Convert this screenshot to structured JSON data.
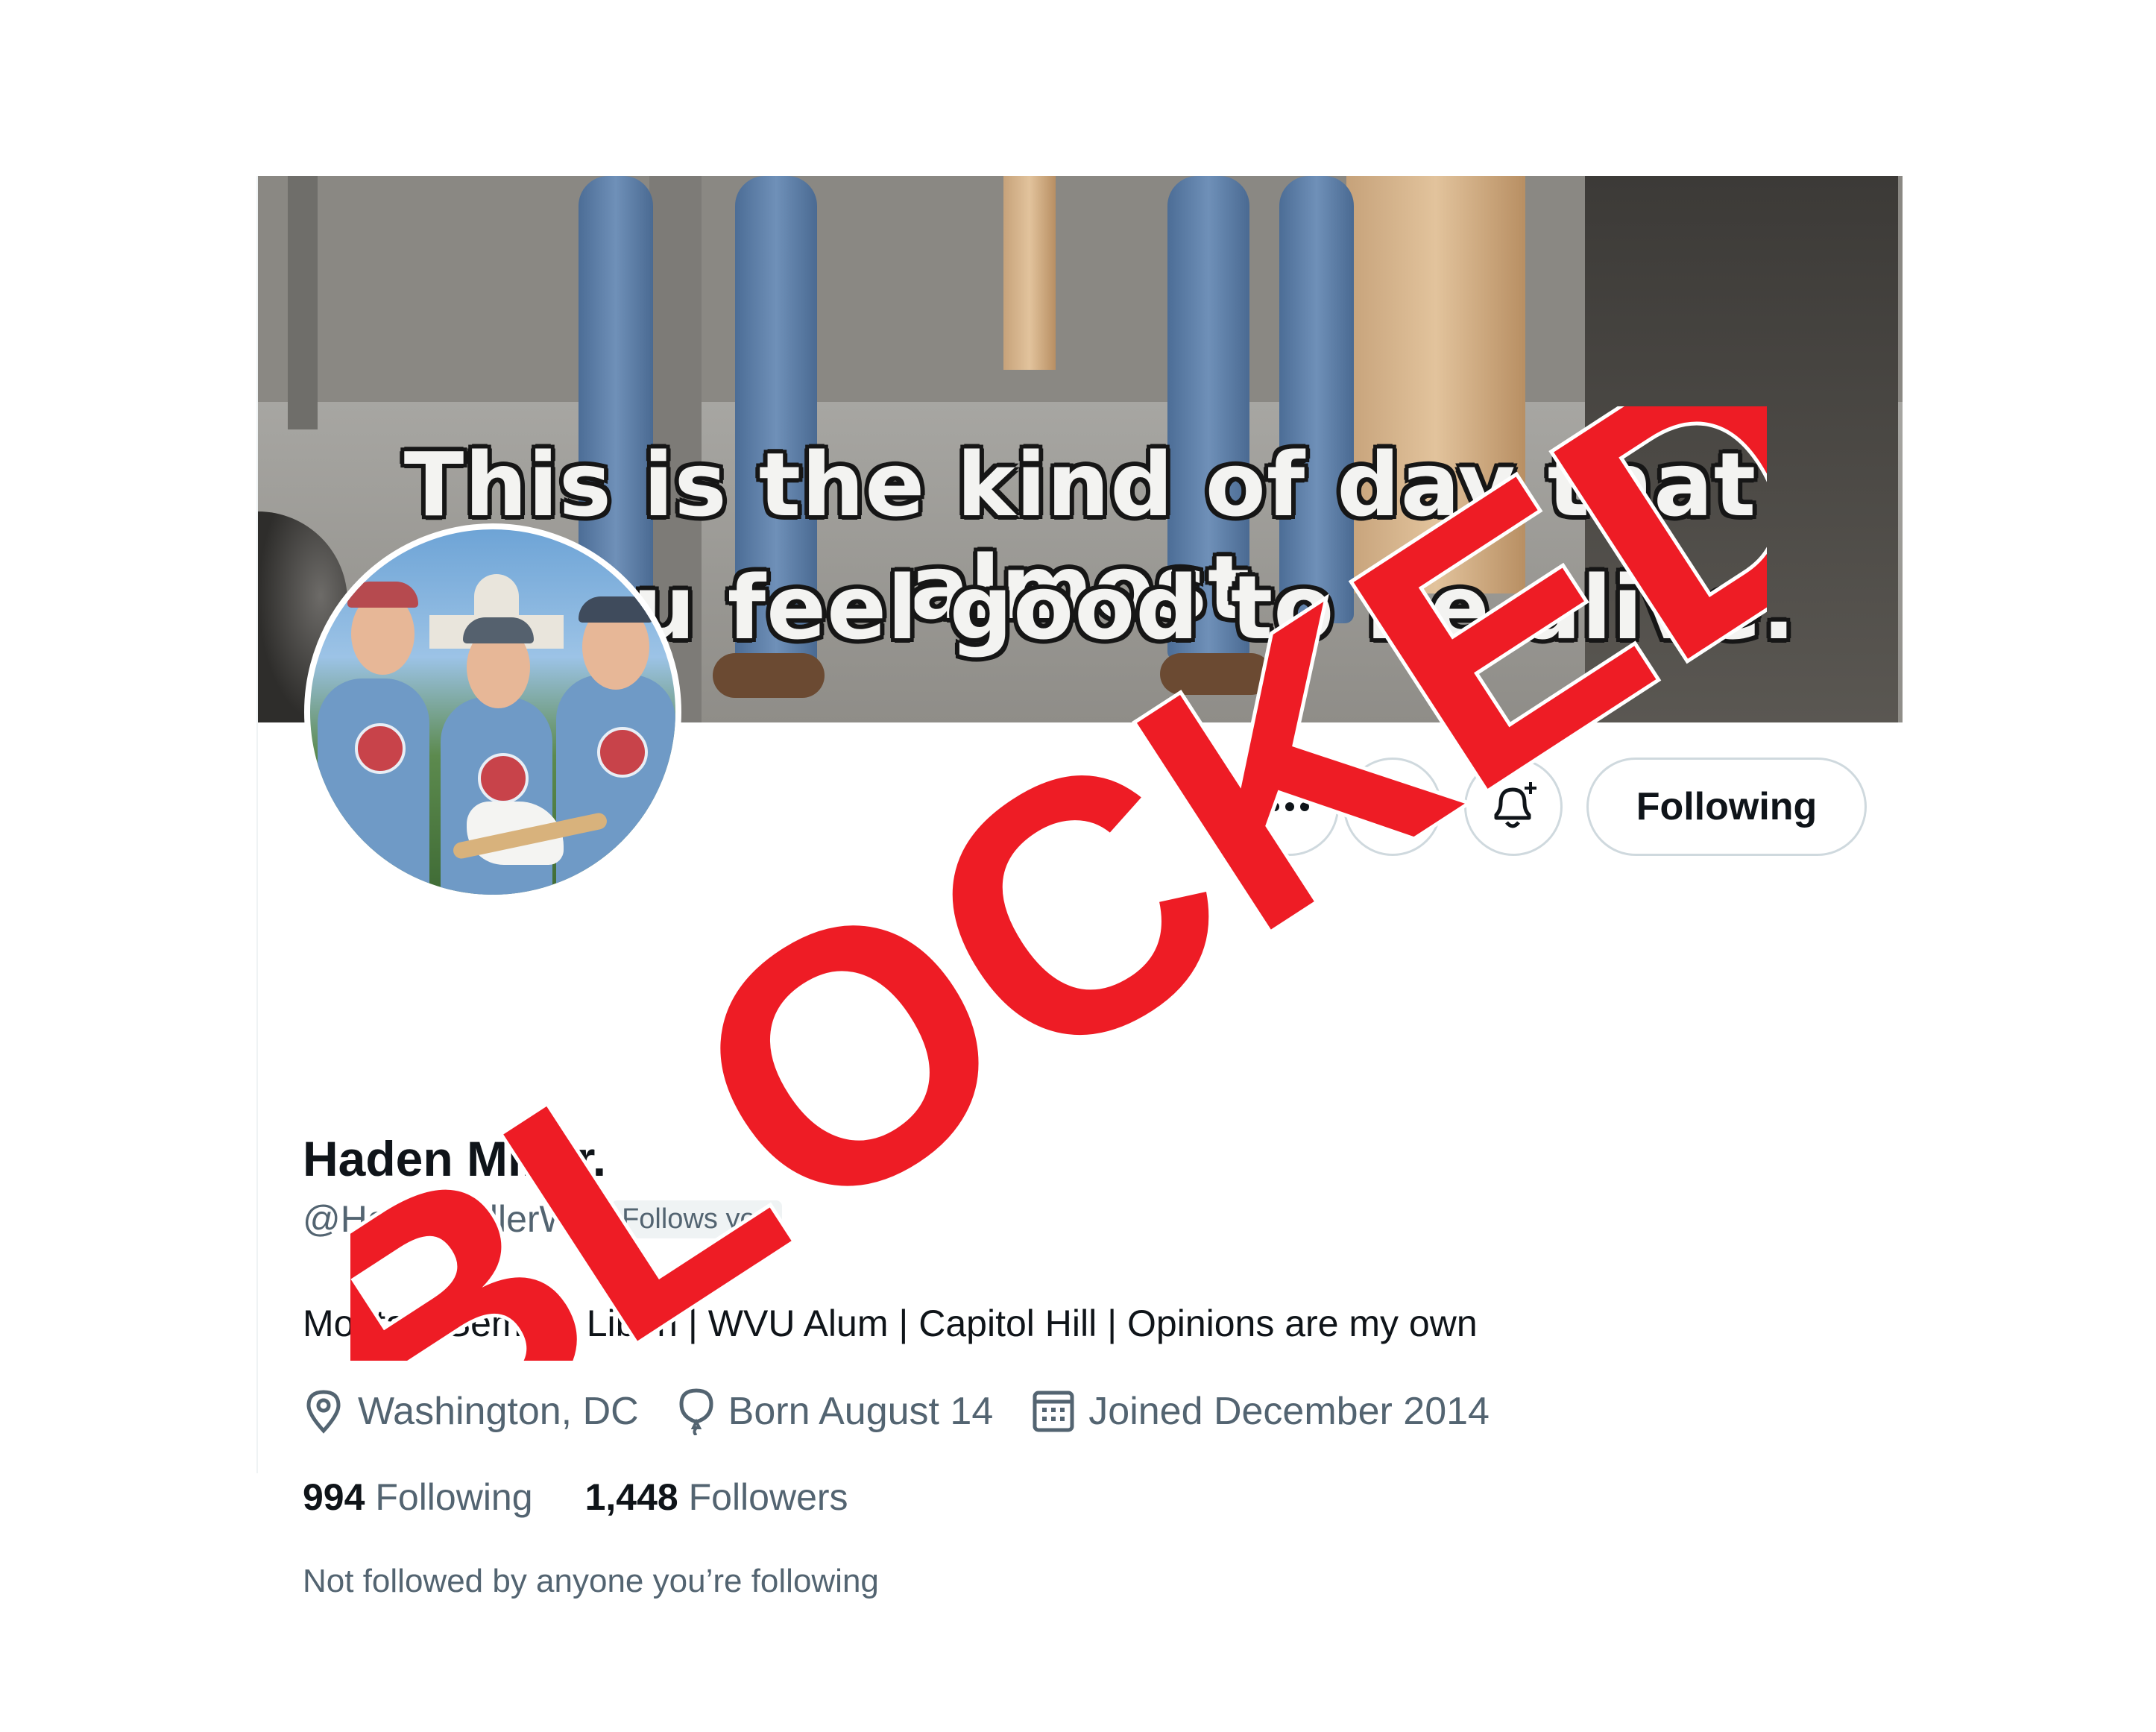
{
  "banner": {
    "caption_line1": "This is the kind of day that almost",
    "caption_line2": "you feel good to be alive."
  },
  "actions": {
    "more_icon": "more-horizontal-icon",
    "message_icon": "envelope-icon",
    "notify_icon": "bell-plus-icon",
    "following_label": "Following"
  },
  "profile": {
    "display_name": "Haden Miller.",
    "handle": "@HadenMillerWV",
    "follows_you": "Follows you",
    "bio": "Montani Semper Liberi | WVU Alum | Capitol Hill | Opinions are my own",
    "location": "Washington, DC",
    "birthday": "Born August 14",
    "joined": "Joined December 2014",
    "following_count": "994",
    "following_label": "Following",
    "followers_count": "1,448",
    "followers_label": "Followers",
    "followed_by": "Not followed by anyone you’re following"
  },
  "overlay": {
    "stamp_text": "BLOCKED",
    "stamp_color": "#ee1c25"
  },
  "colors": {
    "primary_text": "#0f1419",
    "secondary_text": "#536471",
    "border": "#cfd9de"
  }
}
